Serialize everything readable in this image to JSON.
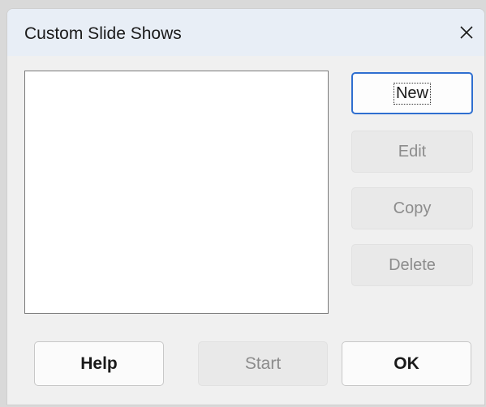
{
  "dialog": {
    "title": "Custom Slide Shows",
    "close_icon": "close-icon"
  },
  "list": {
    "items": []
  },
  "side_buttons": {
    "new_label": "New",
    "edit_label": "Edit",
    "copy_label": "Copy",
    "delete_label": "Delete"
  },
  "bottom_buttons": {
    "help_label": "Help",
    "start_label": "Start",
    "ok_label": "OK"
  },
  "colors": {
    "titlebar_bg": "#e8eef6",
    "focus_border": "#2f6fd0",
    "disabled_text": "#8c8c8c"
  }
}
